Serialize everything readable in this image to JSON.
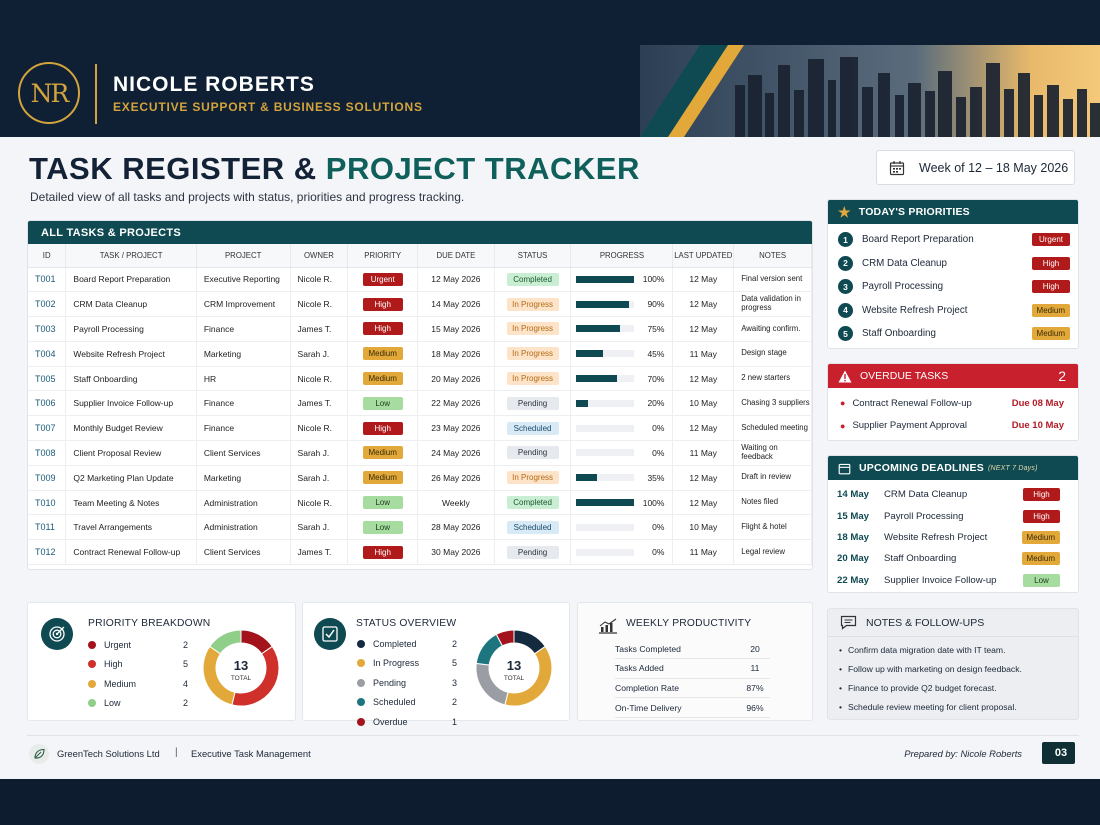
{
  "brand": {
    "monogram": "NR",
    "name": "NICOLE ROBERTS",
    "tagline": "EXECUTIVE SUPPORT & BUSINESS SOLUTIONS"
  },
  "page": {
    "title_a": "TASK REGISTER & ",
    "title_b": "PROJECT TRACKER",
    "subtitle": "Detailed view of all tasks and projects with status, priorities and progress tracking.",
    "week": "Week of 12 – 18 May 2026"
  },
  "tasks_table": {
    "heading": "ALL TASKS & PROJECTS",
    "columns": [
      "ID",
      "TASK / PROJECT",
      "PROJECT",
      "OWNER",
      "PRIORITY",
      "DUE DATE",
      "STATUS",
      "PROGRESS",
      "LAST UPDATED",
      "NOTES"
    ],
    "rows": [
      {
        "id": "T001",
        "task": "Board Report Preparation",
        "project": "Executive Reporting",
        "owner": "Nicole R.",
        "priority": "Urgent",
        "due": "12 May 2026",
        "status": "Completed",
        "progress": 100,
        "progress_label": "100%",
        "updated": "12 May",
        "notes": "Final version sent"
      },
      {
        "id": "T002",
        "task": "CRM Data Cleanup",
        "project": "CRM Improvement",
        "owner": "Nicole R.",
        "priority": "High",
        "due": "14 May 2026",
        "status": "In Progress",
        "progress": 90,
        "progress_label": "90%",
        "updated": "12 May",
        "notes": "Data validation in progress"
      },
      {
        "id": "T003",
        "task": "Payroll Processing",
        "project": "Finance",
        "owner": "James T.",
        "priority": "High",
        "due": "15 May 2026",
        "status": "In Progress",
        "progress": 75,
        "progress_label": "75%",
        "updated": "12 May",
        "notes": "Awaiting confirm."
      },
      {
        "id": "T004",
        "task": "Website Refresh Project",
        "project": "Marketing",
        "owner": "Sarah J.",
        "priority": "Medium",
        "due": "18 May 2026",
        "status": "In Progress",
        "progress": 45,
        "progress_label": "45%",
        "updated": "11 May",
        "notes": "Design stage"
      },
      {
        "id": "T005",
        "task": "Staff Onboarding",
        "project": "HR",
        "owner": "Nicole R.",
        "priority": "Medium",
        "due": "20 May 2026",
        "status": "In Progress",
        "progress": 70,
        "progress_label": "70%",
        "updated": "12 May",
        "notes": "2 new starters"
      },
      {
        "id": "T006",
        "task": "Supplier Invoice Follow-up",
        "project": "Finance",
        "owner": "James T.",
        "priority": "Low",
        "due": "22 May 2026",
        "status": "Pending",
        "progress": 20,
        "progress_label": "20%",
        "updated": "10 May",
        "notes": "Chasing 3 suppliers"
      },
      {
        "id": "T007",
        "task": "Monthly Budget Review",
        "project": "Finance",
        "owner": "Nicole R.",
        "priority": "High",
        "due": "23 May 2026",
        "status": "Scheduled",
        "progress": 0,
        "progress_label": "0%",
        "updated": "12 May",
        "notes": "Scheduled meeting"
      },
      {
        "id": "T008",
        "task": "Client Proposal Review",
        "project": "Client Services",
        "owner": "Sarah J.",
        "priority": "Medium",
        "due": "24 May 2026",
        "status": "Pending",
        "progress": 0,
        "progress_label": "0%",
        "updated": "11 May",
        "notes": "Waiting on feedback"
      },
      {
        "id": "T009",
        "task": "Q2 Marketing Plan Update",
        "project": "Marketing",
        "owner": "Sarah J.",
        "priority": "Medium",
        "due": "26 May 2026",
        "status": "In Progress",
        "progress": 35,
        "progress_label": "35%",
        "updated": "12 May",
        "notes": "Draft in review"
      },
      {
        "id": "T010",
        "task": "Team Meeting & Notes",
        "project": "Administration",
        "owner": "Nicole R.",
        "priority": "Low",
        "due": "Weekly",
        "status": "Completed",
        "progress": 100,
        "progress_label": "100%",
        "updated": "12 May",
        "notes": "Notes filed"
      },
      {
        "id": "T011",
        "task": "Travel Arrangements",
        "project": "Administration",
        "owner": "Sarah J.",
        "priority": "Low",
        "due": "28 May 2026",
        "status": "Scheduled",
        "progress": 0,
        "progress_label": "0%",
        "updated": "10 May",
        "notes": "Flight & hotel"
      },
      {
        "id": "T012",
        "task": "Contract Renewal Follow-up",
        "project": "Client Services",
        "owner": "James T.",
        "priority": "High",
        "due": "30 May 2026",
        "status": "Pending",
        "progress": 0,
        "progress_label": "0%",
        "updated": "11 May",
        "notes": "Legal review"
      }
    ]
  },
  "todays_priorities": {
    "heading": "TODAY'S PRIORITIES",
    "items": [
      {
        "n": "1",
        "task": "Board Report Preparation",
        "priority": "Urgent"
      },
      {
        "n": "2",
        "task": "CRM Data Cleanup",
        "priority": "High"
      },
      {
        "n": "3",
        "task": "Payroll Processing",
        "priority": "High"
      },
      {
        "n": "4",
        "task": "Website Refresh Project",
        "priority": "Medium"
      },
      {
        "n": "5",
        "task": "Staff Onboarding",
        "priority": "Medium"
      }
    ]
  },
  "overdue": {
    "heading": "OVERDUE TASKS",
    "count": "2",
    "items": [
      {
        "task": "Contract Renewal Follow-up",
        "due": "Due 08 May"
      },
      {
        "task": "Supplier Payment Approval",
        "due": "Due 10 May"
      }
    ]
  },
  "upcoming": {
    "heading": "UPCOMING DEADLINES",
    "note": "(NEXT 7 Days)",
    "items": [
      {
        "date": "14 May",
        "task": "CRM Data Cleanup",
        "priority": "High"
      },
      {
        "date": "15 May",
        "task": "Payroll Processing",
        "priority": "High"
      },
      {
        "date": "18 May",
        "task": "Website Refresh Project",
        "priority": "Medium"
      },
      {
        "date": "20 May",
        "task": "Staff Onboarding",
        "priority": "Medium"
      },
      {
        "date": "22 May",
        "task": "Supplier Invoice Follow-up",
        "priority": "Low"
      }
    ]
  },
  "notes": {
    "heading": "NOTES & FOLLOW-UPS",
    "items": [
      "Confirm data migration date with IT team.",
      "Follow up with marketing on design feedback.",
      "Finance to provide Q2 budget forecast.",
      "Schedule review meeting for client proposal."
    ]
  },
  "priority_breakdown": {
    "heading": "PRIORITY BREAKDOWN",
    "total": "13",
    "total_label": "TOTAL",
    "items": [
      {
        "label": "Urgent",
        "value": 2,
        "color": "#a3131c"
      },
      {
        "label": "High",
        "value": 5,
        "color": "#d0302a"
      },
      {
        "label": "Medium",
        "value": 4,
        "color": "#e2a93a"
      },
      {
        "label": "Low",
        "value": 2,
        "color": "#8fcf89"
      }
    ]
  },
  "status_overview": {
    "heading": "STATUS OVERVIEW",
    "total": "13",
    "total_label": "TOTAL",
    "items": [
      {
        "label": "Completed",
        "value": 2,
        "color": "#132a3f"
      },
      {
        "label": "In Progress",
        "value": 5,
        "color": "#e2a93a"
      },
      {
        "label": "Pending",
        "value": 3,
        "color": "#9a9ea4"
      },
      {
        "label": "Scheduled",
        "value": 2,
        "color": "#1d7580"
      },
      {
        "label": "Overdue",
        "value": 1,
        "color": "#a3131c"
      }
    ]
  },
  "weekly": {
    "heading": "WEEKLY PRODUCTIVITY",
    "rows": [
      {
        "label": "Tasks Completed",
        "value": "20"
      },
      {
        "label": "Tasks Added",
        "value": "11"
      },
      {
        "label": "Completion Rate",
        "value": "87%"
      },
      {
        "label": "On-Time Delivery",
        "value": "96%"
      }
    ]
  },
  "footer": {
    "company": "GreenTech Solutions Ltd",
    "sep": "|",
    "doc": "Executive Task Management",
    "prepared": "Prepared by: Nicole Roberts",
    "page": "03"
  }
}
